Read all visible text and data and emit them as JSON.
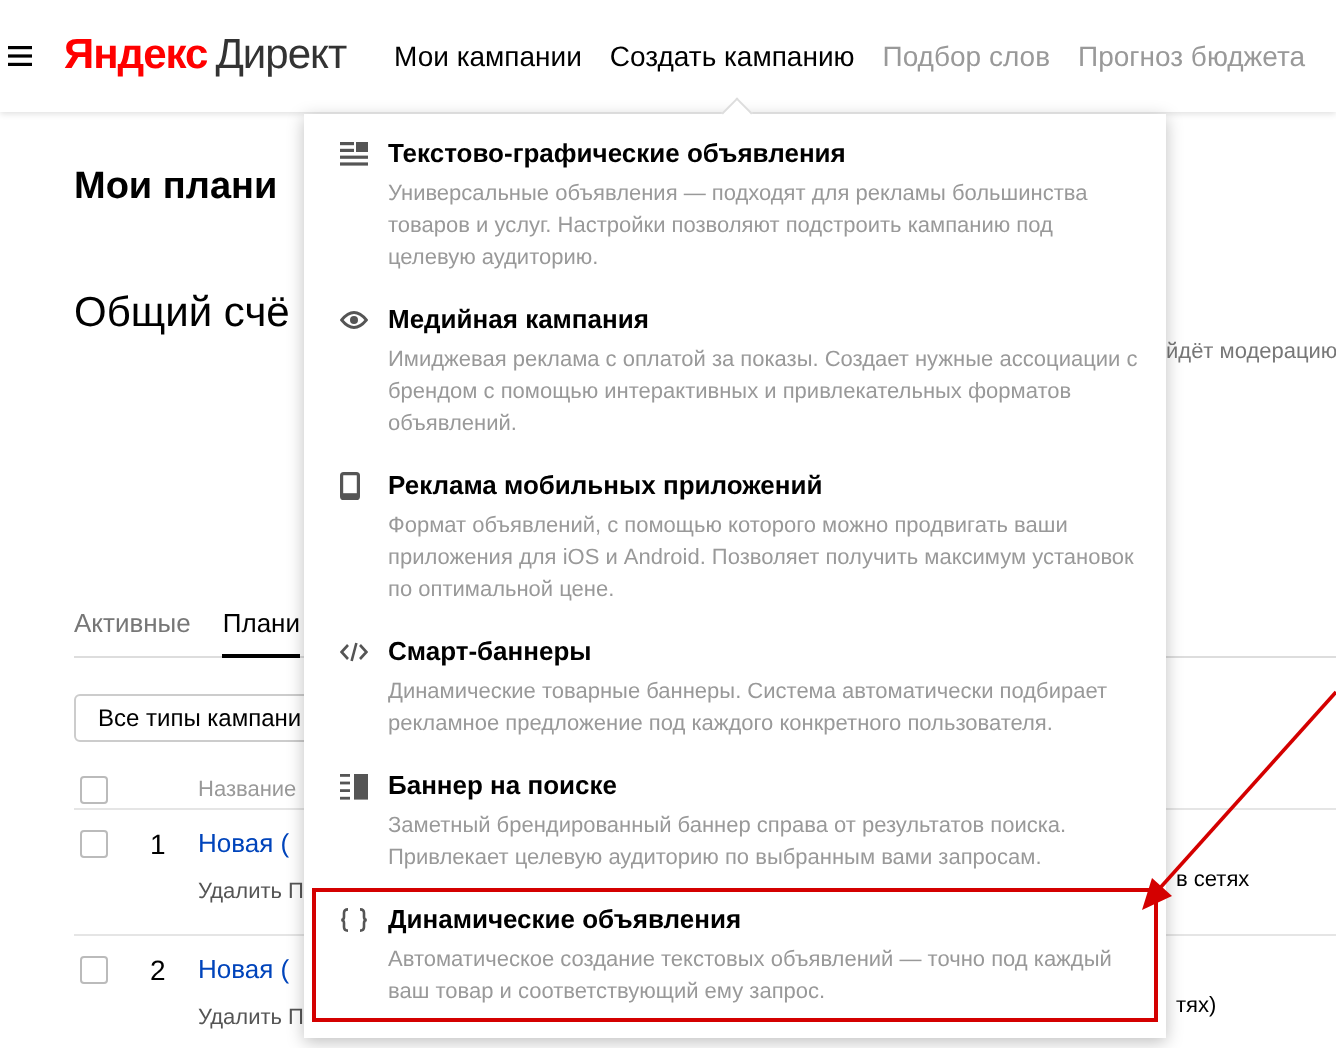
{
  "header": {
    "logo_brand": "Яндекс",
    "logo_product": "Директ",
    "nav": [
      {
        "label": "Мои кампании",
        "disabled": false
      },
      {
        "label": "Создать кампанию",
        "disabled": false
      },
      {
        "label": "Подбор слов",
        "disabled": true
      },
      {
        "label": "Прогноз бюджета",
        "disabled": true
      }
    ]
  },
  "page": {
    "title": "Мои плани",
    "account_title": "Общий счё",
    "moderation_note": "йдёт модерацию",
    "tabs": [
      {
        "label": "Активные",
        "selected": false
      },
      {
        "label": "Плани",
        "selected": true
      }
    ],
    "filter": "Все типы кампани",
    "table": {
      "select_all_checked": false,
      "columns": [
        "Название"
      ],
      "rows": [
        {
          "checked": false,
          "number": "1",
          "name": "Новая (",
          "actions": "Удалить П",
          "column_3": "в сетях"
        },
        {
          "checked": false,
          "number": "2",
          "name": "Новая (",
          "actions": "Удалить П",
          "column_3": "тях)"
        }
      ]
    }
  },
  "create_menu": {
    "items": [
      {
        "kind": "text-graphic",
        "title": "Текстово-графические объявления",
        "description": "Универсальные объявления — подходят для рекламы большинства товаров и услуг. Настройки позволяют подстроить кампанию под целевую аудиторию.",
        "highlighted": false
      },
      {
        "kind": "media",
        "title": "Медийная кампания",
        "description": "Имиджевая реклама с оплатой за показы. Создает нужные ассоциации с брендом с помощью интерактивных и привлекательных форматов объявлений.",
        "highlighted": false
      },
      {
        "kind": "mobile",
        "title": "Реклама мобильных приложений",
        "description": "Формат объявлений, с помощью которого можно продвигать ваши приложения для iOS и Android. Позволяет получить максимум установок по оптимальной цене.",
        "highlighted": false
      },
      {
        "kind": "smart",
        "title": "Смарт-баннеры",
        "description": "Динамические товарные баннеры. Система автоматически подбирает рекламное предложение под каждого конкретного пользователя.",
        "highlighted": false
      },
      {
        "kind": "search-banner",
        "title": "Баннер на поиске",
        "description": "Заметный брендированный баннер справа от результатов поиска. Привлекает целевую аудиторию по выбранным вами запросам.",
        "highlighted": false
      },
      {
        "kind": "dynamic",
        "title": "Динамические объявления",
        "description": "Автоматическое создание текстовых объявлений — точно под каждый ваш товар и соответствующий ему запрос.",
        "highlighted": true
      }
    ]
  }
}
